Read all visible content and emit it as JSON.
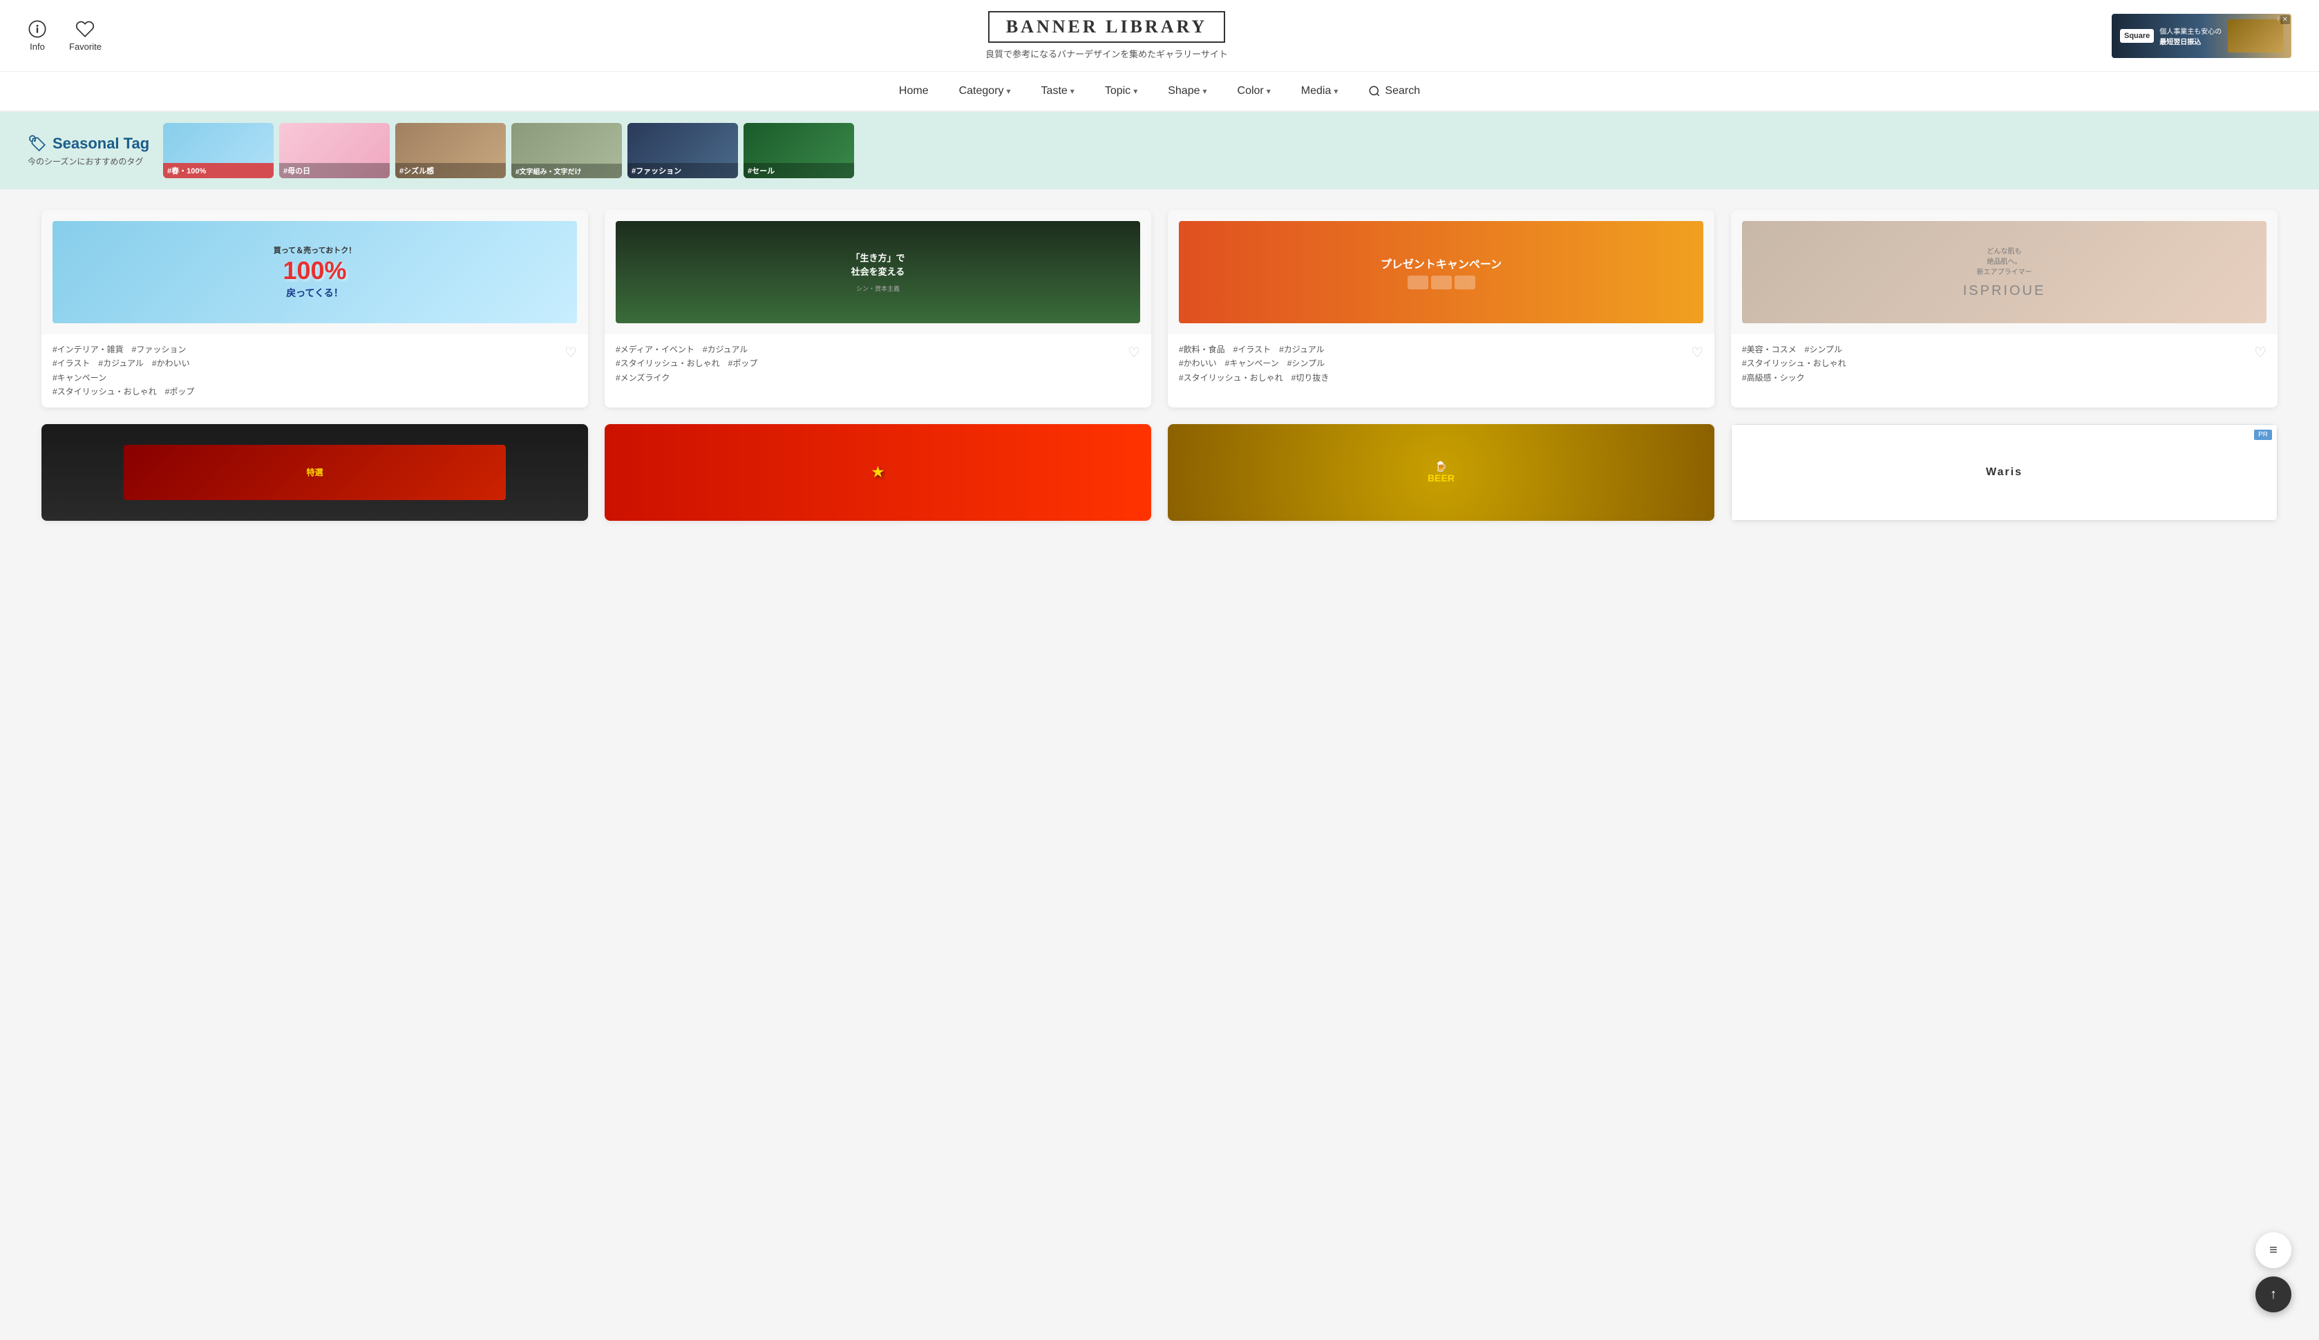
{
  "site": {
    "title": "BANNER LIBRARY",
    "subtitle": "良質で参考になるバナーデザインを集めたギャラリーサイト"
  },
  "header": {
    "info_label": "Info",
    "favorite_label": "Favorite"
  },
  "nav": {
    "items": [
      {
        "label": "Home",
        "has_dropdown": false
      },
      {
        "label": "Category",
        "has_dropdown": true
      },
      {
        "label": "Taste",
        "has_dropdown": true
      },
      {
        "label": "Topic",
        "has_dropdown": true
      },
      {
        "label": "Shape",
        "has_dropdown": true
      },
      {
        "label": "Color",
        "has_dropdown": true
      },
      {
        "label": "Media",
        "has_dropdown": true
      }
    ],
    "search_label": "Search"
  },
  "seasonal": {
    "title": "Seasonal Tag",
    "icon": "🏷",
    "subtitle": "今のシーズンにおすすめのタグ",
    "tags": [
      {
        "label": "#春・100%",
        "bg_class": "tag-1"
      },
      {
        "label": "#母の日",
        "bg_class": "tag-2"
      },
      {
        "label": "#シズル感",
        "bg_class": "tag-3"
      },
      {
        "label": "#文字組み・文字だけ",
        "bg_class": "tag-4"
      },
      {
        "label": "#ファッション",
        "bg_class": "tag-5"
      },
      {
        "label": "#セール",
        "bg_class": "tag-6"
      }
    ]
  },
  "cards": [
    {
      "banner_type": "bm1",
      "banner_content": "買って＆売っておトク！\n100%\n戻ってくる！",
      "tags": "#インテリア・雑貨　#ファッション\n#イラスト　#カジュアル　#かわいい\n#キャンペーン\n#スタイリッシュ・おしゃれ　#ポップ"
    },
    {
      "banner_type": "bm2",
      "banner_content": "「生き方」で\n社会を変える",
      "tags": "#メディア・イベント　#カジュアル\n#スタイリッシュ・おしゃれ　#ポップ\n#メンズライク"
    },
    {
      "banner_type": "bm3",
      "banner_content": "プレゼントキャンペーン",
      "tags": "#飲料・食品　#イラスト　#カジュアル\n#かわいい　#キャンペーン　#シンプル\n#スタイリッシュ・おしゃれ　#切り抜き"
    },
    {
      "banner_type": "bm4",
      "banner_content": "ISPRIOUE",
      "tags": "#美容・コスメ　#シンプル\n#スタイリッシュ・おしゃれ\n#高級感・シック"
    }
  ],
  "row2_cards": [
    {
      "type": "dark",
      "label": ""
    },
    {
      "type": "red_gold",
      "label": ""
    },
    {
      "type": "beer",
      "label": ""
    },
    {
      "type": "waris",
      "label": "Waris",
      "pr": true
    }
  ],
  "fab": {
    "menu_label": "≡",
    "up_label": "↑"
  },
  "ad": {
    "logo": "Square",
    "line1": "個人事業主も安心の",
    "line2": "最短翌日振込",
    "close": "✕",
    "info": "i"
  }
}
